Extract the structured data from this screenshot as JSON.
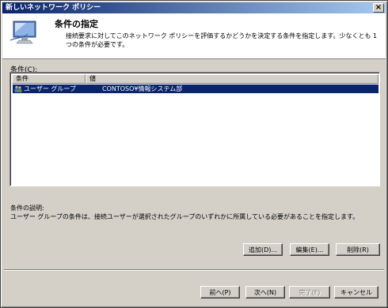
{
  "window": {
    "title": "新しいネットワーク ポリシー",
    "close_glyph": "×"
  },
  "header": {
    "title": "条件の指定",
    "description": "接続要求に対してこのネットワーク ポリシーを評価するかどうかを決定する条件を指定します。少なくとも 1 つの条件が必要です。"
  },
  "conditions": {
    "label": "条件(C):",
    "columns": {
      "condition": "条件",
      "value": "値"
    },
    "rows": [
      {
        "condition": "ユーザー グループ",
        "value": "CONTOSO¥情報システム部"
      }
    ]
  },
  "description_section": {
    "label": "条件の説明:",
    "text": "ユーザー グループの条件は、接続ユーザーが選択されたグループのいずれかに所属している必要があることを指定します。"
  },
  "action_buttons": {
    "add": "追加(D)...",
    "edit": "編集(E)...",
    "delete": "削除(R)"
  },
  "nav_buttons": {
    "back": "前へ(P)",
    "next": "次へ(N)",
    "finish": "完了(F)",
    "cancel": "キャンセル"
  }
}
